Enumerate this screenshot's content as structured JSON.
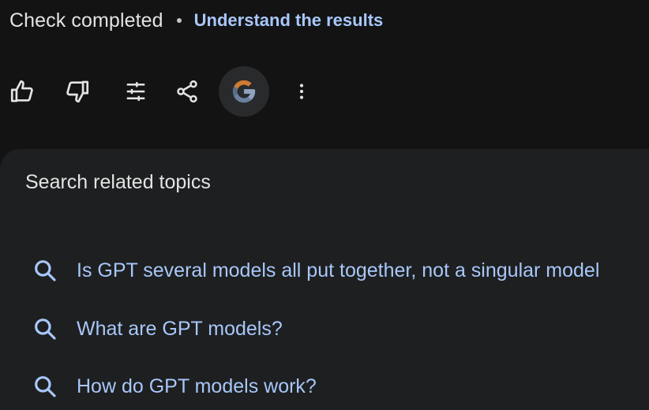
{
  "status": {
    "text": "Check completed",
    "separator": "•",
    "link": "Understand the results"
  },
  "toolbar": {
    "buttons": [
      {
        "name": "thumbs-up-icon"
      },
      {
        "name": "thumbs-down-icon"
      },
      {
        "name": "sliders-icon"
      },
      {
        "name": "share-icon"
      },
      {
        "name": "google-g-icon"
      },
      {
        "name": "more-vert-icon"
      }
    ]
  },
  "related": {
    "title": "Search related topics",
    "items": [
      {
        "label": "Is GPT several models all put together, not a singular model"
      },
      {
        "label": "What are GPT models?"
      },
      {
        "label": "How do GPT models work?"
      }
    ]
  },
  "colors": {
    "background": "#131314",
    "panel": "#1e1f20",
    "text": "#e3e3e3",
    "link": "#a8c7fa",
    "icon": "#e3e3e3",
    "g_button_bg": "#282a2c"
  }
}
